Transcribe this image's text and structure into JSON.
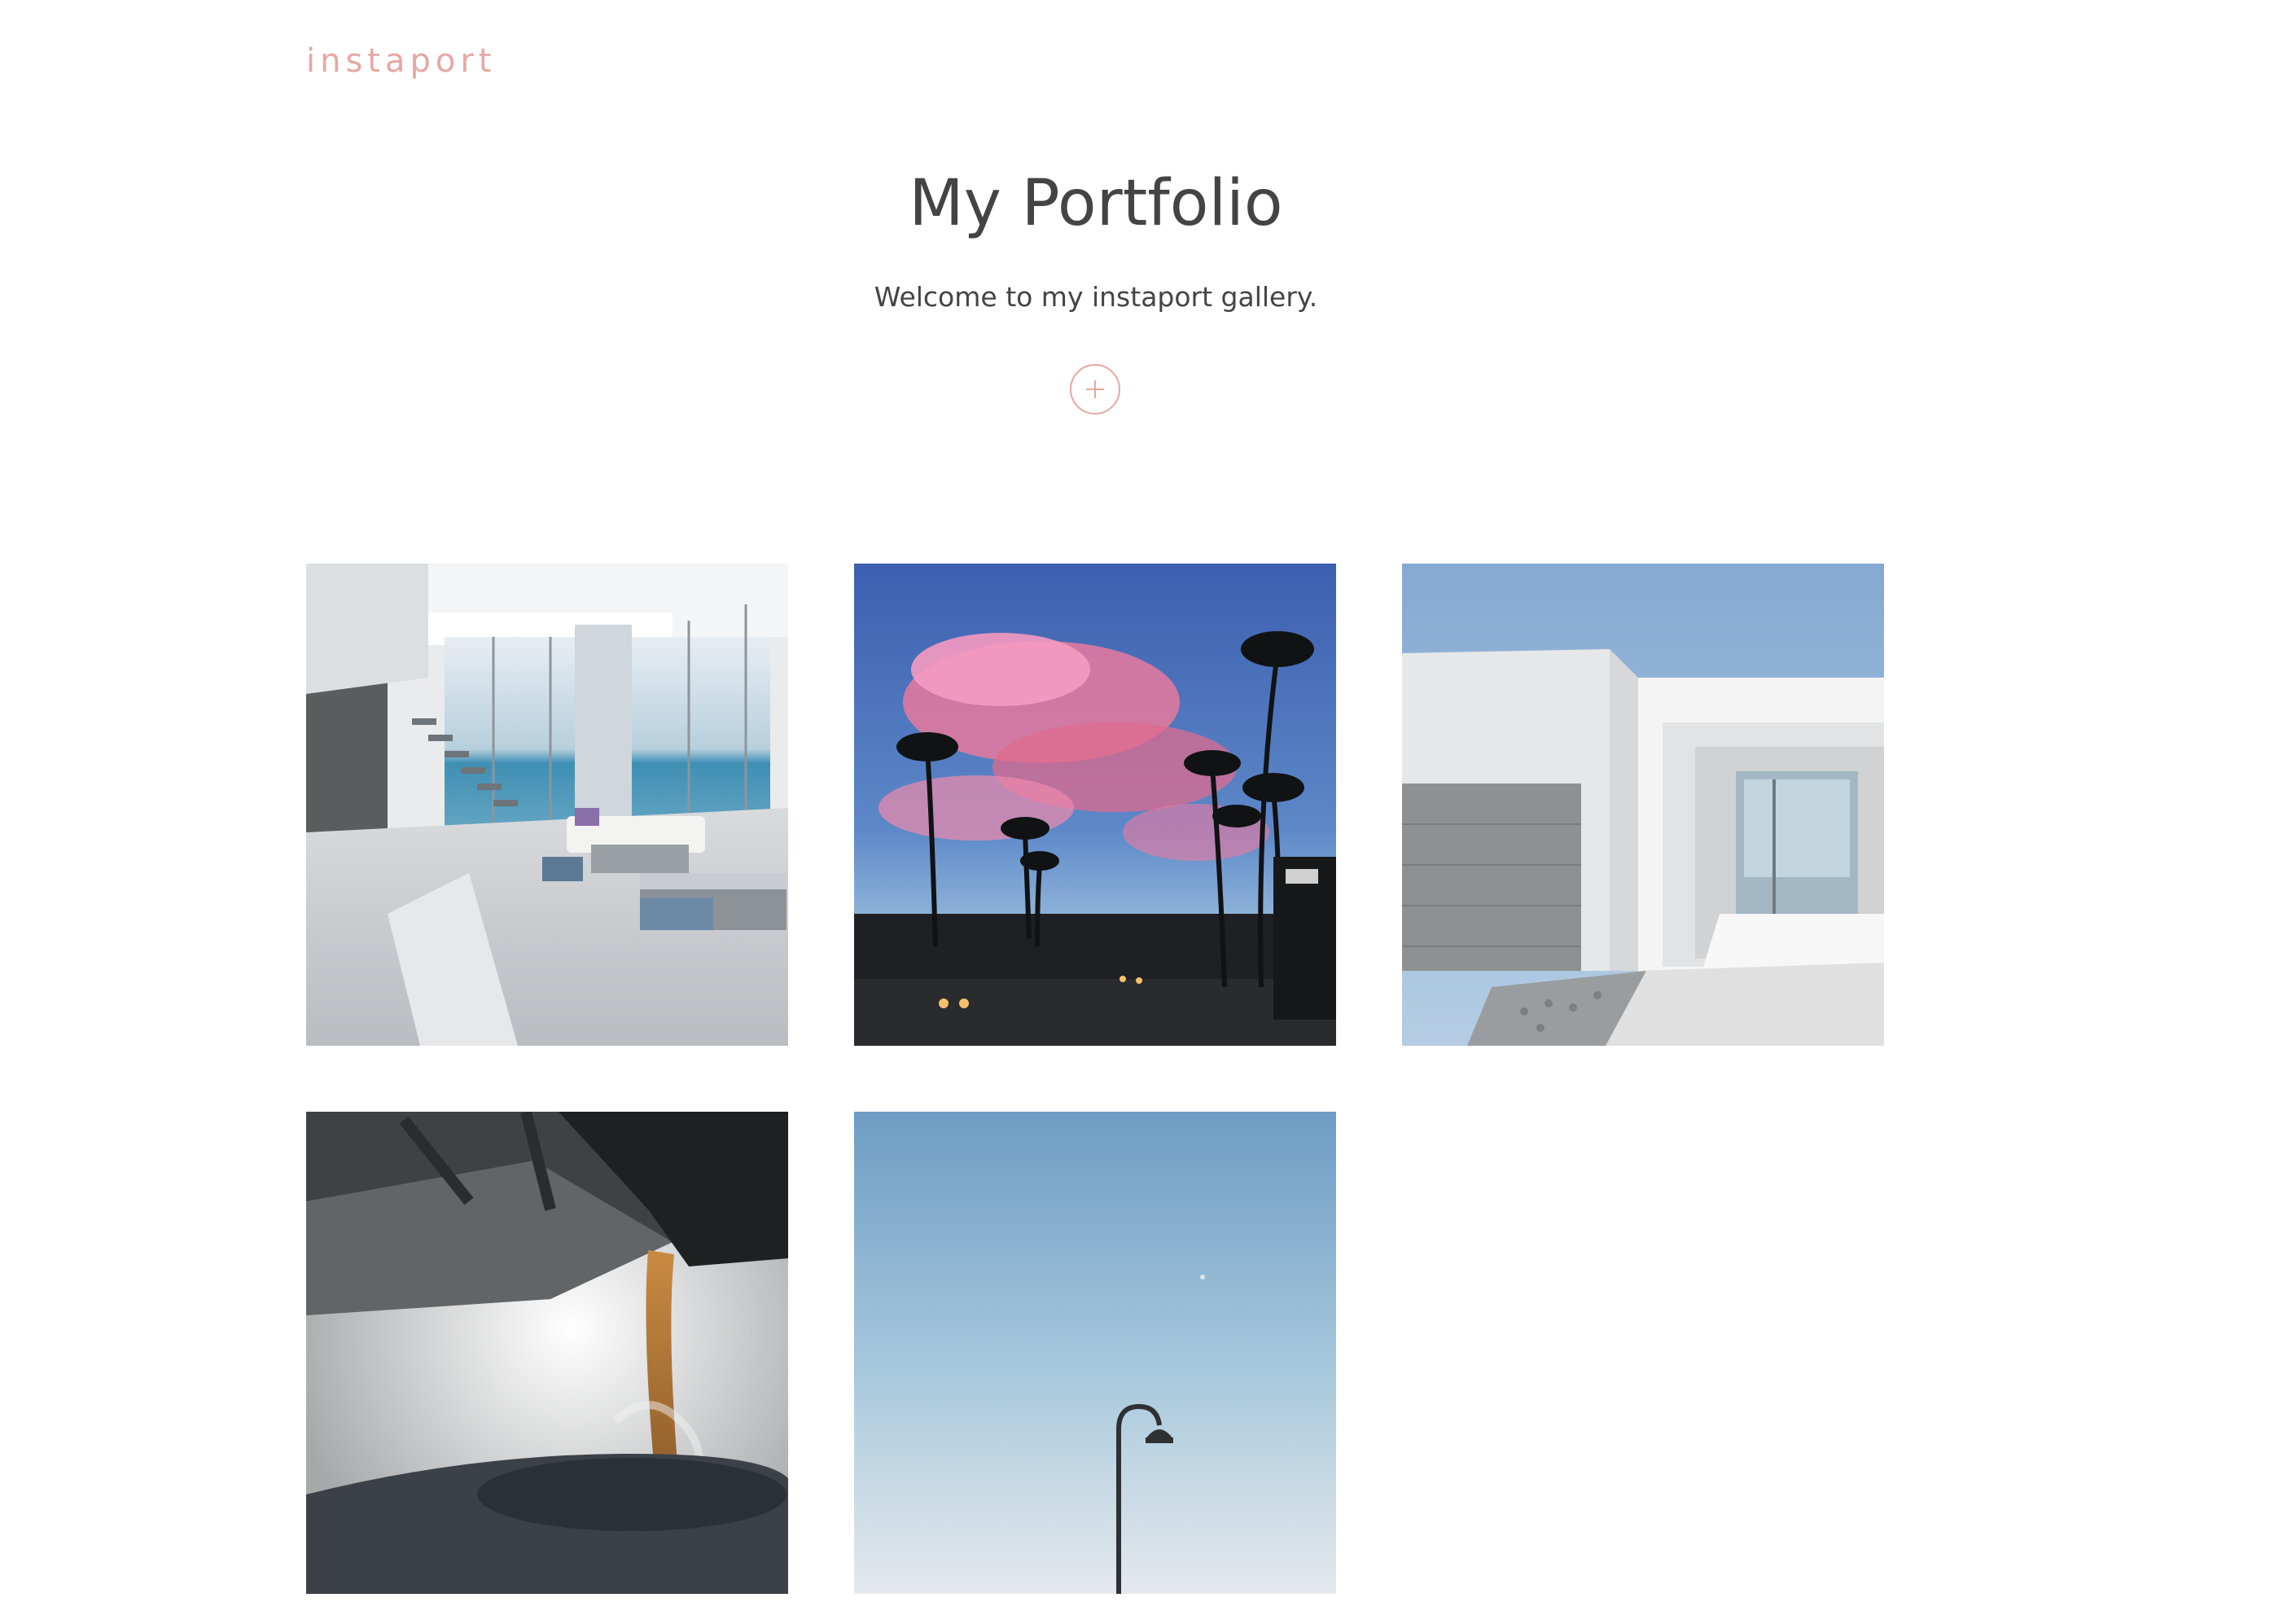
{
  "header": {
    "logo_text": "instaport",
    "brand_color": "#e7a7a3"
  },
  "hero": {
    "title": "My Portfolio",
    "subtitle": "Welcome to my instaport gallery.",
    "add_button_icon": "plus-icon"
  },
  "gallery": {
    "photos": [
      {
        "subject": "modern living room interior with ocean view"
      },
      {
        "subject": "palm trees under pink sunset sky over street"
      },
      {
        "subject": "white modern house exterior with glass entrance"
      },
      {
        "subject": "coffee pouring from glass carafe into mug"
      },
      {
        "subject": "street lamp against blue sky"
      }
    ]
  },
  "colors": {
    "text": "#444444",
    "accent": "#e7a7a3",
    "background": "#ffffff"
  }
}
